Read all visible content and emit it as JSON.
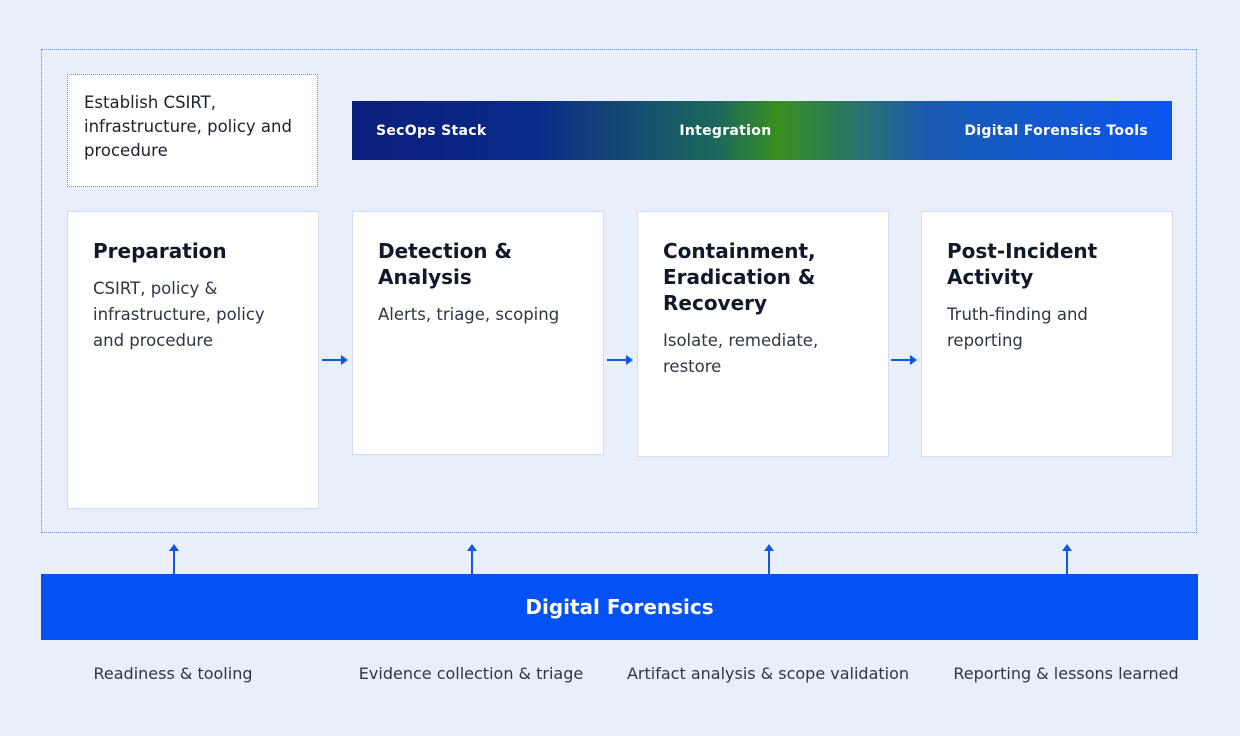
{
  "note": "Establish CSIRT, infrastructure, policy and procedure",
  "band": {
    "left": "SecOps Stack",
    "center": "Integration",
    "right": "Digital Forensics Tools"
  },
  "phases": [
    {
      "title": "Preparation",
      "desc": "CSIRT, policy & infrastructure, policy and procedure"
    },
    {
      "title": "Detection & Analysis",
      "desc": "Alerts, triage, scoping"
    },
    {
      "title": "Containment, Eradication & Recovery",
      "desc": "Isolate, remediate, restore"
    },
    {
      "title": "Post-Incident Activity",
      "desc": "Truth-finding and reporting"
    }
  ],
  "foundation": "Digital Forensics",
  "captions": [
    "Readiness & tooling",
    "Evidence collection & triage",
    "Artifact analysis & scope validation",
    "Reporting & lessons learned"
  ]
}
